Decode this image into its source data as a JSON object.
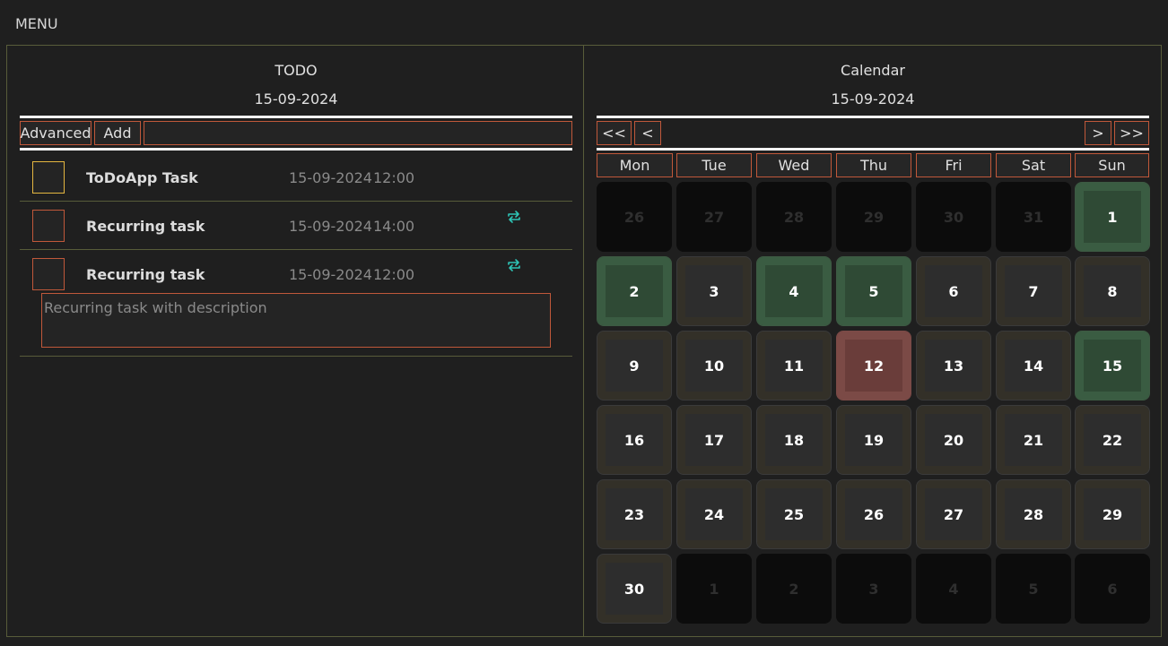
{
  "menu": {
    "label": "MENU"
  },
  "todo": {
    "title": "TODO",
    "date": "15-09-2024",
    "advanced_label": "Advanced",
    "add_label": "Add",
    "input_value": "",
    "tasks": [
      {
        "name": "ToDoApp Task",
        "date": "15-09-2024",
        "time": "12:00",
        "recurring": false
      },
      {
        "name": "Recurring task",
        "date": "15-09-2024",
        "time": "14:00",
        "recurring": true
      },
      {
        "name": "Recurring task",
        "date": "15-09-2024",
        "time": "12:00",
        "recurring": true,
        "description": "Recurring task with description"
      }
    ]
  },
  "calendar": {
    "title": "Calendar",
    "date": "15-09-2024",
    "nav": {
      "first": "<<",
      "prev": "<",
      "next": ">",
      "last": ">>"
    },
    "weekdays": [
      "Mon",
      "Tue",
      "Wed",
      "Thu",
      "Fri",
      "Sat",
      "Sun"
    ],
    "cells": [
      {
        "d": "26",
        "s": "out"
      },
      {
        "d": "27",
        "s": "out"
      },
      {
        "d": "28",
        "s": "out"
      },
      {
        "d": "29",
        "s": "out"
      },
      {
        "d": "30",
        "s": "out"
      },
      {
        "d": "31",
        "s": "out"
      },
      {
        "d": "1",
        "s": "green"
      },
      {
        "d": "2",
        "s": "green"
      },
      {
        "d": "3",
        "s": "normal"
      },
      {
        "d": "4",
        "s": "green"
      },
      {
        "d": "5",
        "s": "green"
      },
      {
        "d": "6",
        "s": "normal"
      },
      {
        "d": "7",
        "s": "normal"
      },
      {
        "d": "8",
        "s": "normal"
      },
      {
        "d": "9",
        "s": "normal"
      },
      {
        "d": "10",
        "s": "normal"
      },
      {
        "d": "11",
        "s": "normal"
      },
      {
        "d": "12",
        "s": "red"
      },
      {
        "d": "13",
        "s": "normal"
      },
      {
        "d": "14",
        "s": "normal"
      },
      {
        "d": "15",
        "s": "green"
      },
      {
        "d": "16",
        "s": "normal"
      },
      {
        "d": "17",
        "s": "normal"
      },
      {
        "d": "18",
        "s": "normal"
      },
      {
        "d": "19",
        "s": "normal"
      },
      {
        "d": "20",
        "s": "normal"
      },
      {
        "d": "21",
        "s": "normal"
      },
      {
        "d": "22",
        "s": "normal"
      },
      {
        "d": "23",
        "s": "normal"
      },
      {
        "d": "24",
        "s": "normal"
      },
      {
        "d": "25",
        "s": "normal"
      },
      {
        "d": "26",
        "s": "normal"
      },
      {
        "d": "27",
        "s": "normal"
      },
      {
        "d": "28",
        "s": "normal"
      },
      {
        "d": "29",
        "s": "normal"
      },
      {
        "d": "30",
        "s": "normal"
      },
      {
        "d": "1",
        "s": "out"
      },
      {
        "d": "2",
        "s": "out"
      },
      {
        "d": "3",
        "s": "out"
      },
      {
        "d": "4",
        "s": "out"
      },
      {
        "d": "5",
        "s": "out"
      },
      {
        "d": "6",
        "s": "out"
      }
    ]
  },
  "colors": {
    "accent_border": "#c0583a",
    "selected_checkbox": "#e4b640",
    "recur_icon": "#2ec4b6",
    "status_green": "#2f4a35",
    "status_red": "#6a3d3a"
  }
}
